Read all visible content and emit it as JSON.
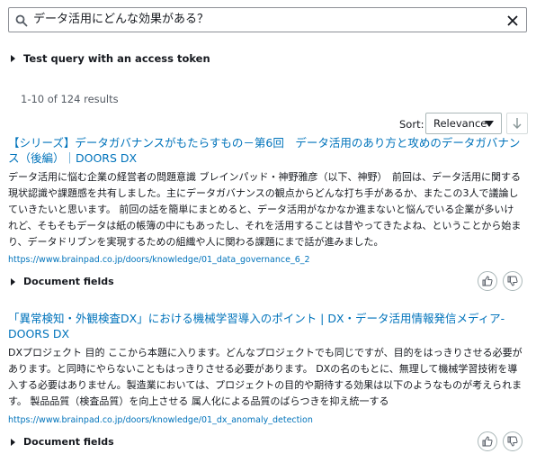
{
  "search": {
    "query": "データ活用にどんな効果がある？"
  },
  "token_toggle": {
    "label": "Test query with an access token"
  },
  "results_count": "1-10 of 124 results",
  "sort": {
    "label": "Sort:",
    "selected": "Relevance"
  },
  "results": [
    {
      "title": "【シリーズ】データガバナンスがもたらすもの－第6回　データ活用のあり方と攻めのデータガバナンス（後編）｜DOORS DX",
      "excerpt": "データ活用に悩む企業の経営者の問題意識 ブレインパッド・神野雅彦（以下、神野）　前回は、データ活用に関する現状認識や課題感を共有しました。主にデータガバナンスの観点からどんな打ち手があるか、またこの3人で議論していきたいと思います。 前回の話を簡単にまとめると、データ活用がなかなか進まないと悩んでいる企業が多いけれど、そもそもデータは紙の帳簿の中にもあったし、それを活用することは昔やってきたよね、ということから始まり、データドリブンを実現するための組織や人に関わる課題にまで話が進みました。",
      "url": "https://www.brainpad.co.jp/doors/knowledge/01_data_governance_6_2",
      "document_fields_label": "Document fields"
    },
    {
      "title": "「異常検知・外観検査DX」における機械学習導入のポイント | DX・データ活用情報発信メディア-DOORS DX",
      "excerpt": "DXプロジェクト 目的 ここから本題に入ります。どんなプロジェクトでも同じですが、目的をはっきりさせる必要があります。と同時にやらないこともはっきりさせる必要があります。 DXの名のもとに、無理して機械学習技術を導入する必要はありません。製造業においては、プロジェクトの目的や期待する効果は以下のようなものが考えられます。 製品品質（検査品質）を向上させる 属人化による品質のばらつきを抑え統一する",
      "url": "https://www.brainpad.co.jp/doors/knowledge/01_dx_anomaly_detection",
      "document_fields_label": "Document fields"
    }
  ]
}
